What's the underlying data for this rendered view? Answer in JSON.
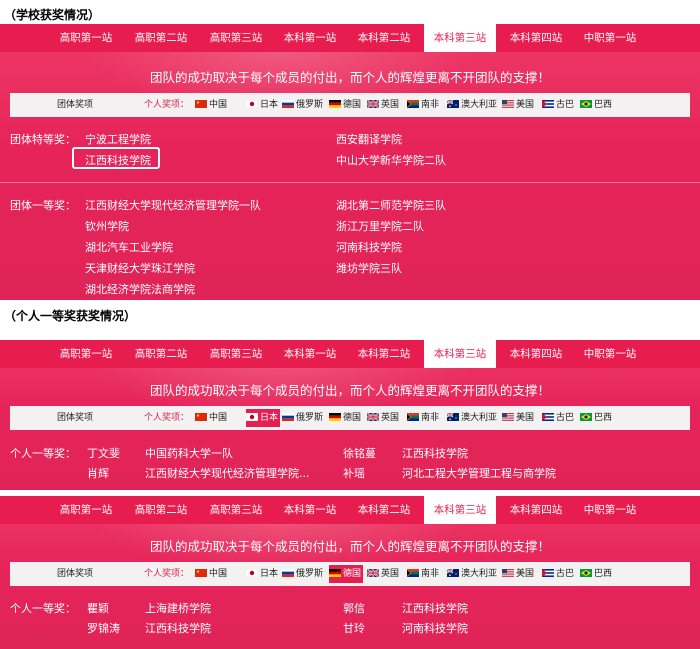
{
  "headings": {
    "school": "（学校获奖情况）",
    "individual": "（个人一等奖获奖情况）"
  },
  "nav": {
    "tabs": [
      "高职第一站",
      "高职第二站",
      "高职第三站",
      "本科第一站",
      "本科第二站",
      "本科第三站",
      "本科第四站",
      "中职第一站"
    ],
    "active_index": 5
  },
  "slogan": "团队的成功取决于每个成员的付出，而个人的辉煌更离不开团队的支撑！",
  "filter": {
    "group_label": "团体奖项",
    "person_label": "个人奖项：",
    "countries": [
      {
        "name": "中国",
        "flag": "china-flag"
      },
      {
        "name": "日本",
        "flag": "japan-flag"
      },
      {
        "name": "俄罗斯",
        "flag": "russia-flag"
      },
      {
        "name": "德国",
        "flag": "germany-flag"
      },
      {
        "name": "英国",
        "flag": "uk-flag"
      },
      {
        "name": "南非",
        "flag": "south-africa-flag"
      },
      {
        "name": "澳大利亚",
        "flag": "australia-flag"
      },
      {
        "name": "美国",
        "flag": "usa-flag"
      },
      {
        "name": "古巴",
        "flag": "cuba-flag"
      },
      {
        "name": "巴西",
        "flag": "brazil-flag"
      }
    ]
  },
  "panel1": {
    "special_label": "团体特等奖：",
    "special": [
      "宁波工程学院",
      "江西科技学院",
      "西安翻译学院",
      "中山大学新华学院二队"
    ],
    "first_label": "团体一等奖：",
    "first": [
      "江西财经大学现代经济管理学院一队",
      "钦州学院",
      "湖北汽车工业学院",
      "天津财经大学珠江学院",
      "湖北经济学院法商学院",
      "湖北第二师范学院三队",
      "浙江万里学院二队",
      "河南科技学院",
      "潍坊学院三队"
    ]
  },
  "panel2": {
    "selected_country": "日本",
    "label": "个人一等奖：",
    "rows": [
      [
        "丁文斐",
        "中国药科大学一队",
        "徐铭蔓",
        "江西科技学院"
      ],
      [
        "肖辉",
        "江西财经大学现代经济管理学院...",
        "补瑶",
        "河北工程大学管理工程与商学院"
      ]
    ]
  },
  "panel3": {
    "selected_country": "德国",
    "label": "个人一等奖：",
    "rows": [
      [
        "瞿颖",
        "上海建桥学院",
        "郭信",
        "江西科技学院"
      ],
      [
        "罗锦涛",
        "江西科技学院",
        "甘玲",
        "河南科技学院"
      ]
    ]
  },
  "colors": {
    "accent": "#e61f52",
    "nav": "#e81d4f",
    "panel": "#e8285a",
    "filter_bar": "#f3f1f1"
  }
}
